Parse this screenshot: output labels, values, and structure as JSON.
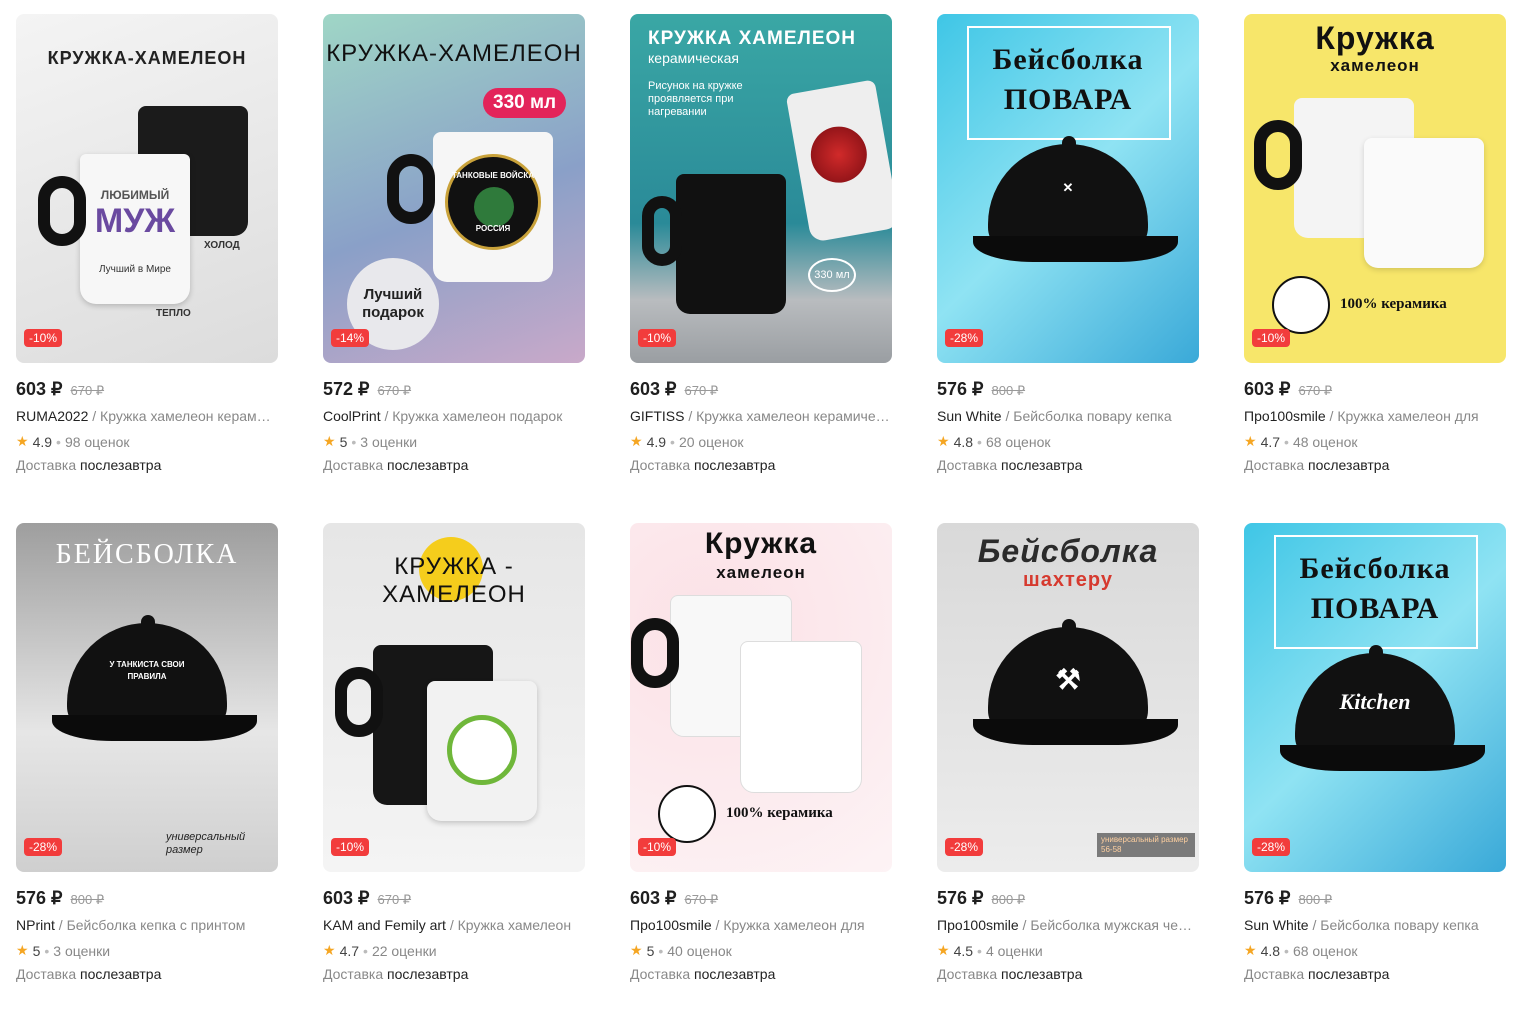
{
  "products": [
    {
      "headline": "КРУЖКА-ХАМЕЛЕОН",
      "art": [
        "ЛЮБИМЫЙ",
        "МУЖ",
        "Лучший в Мире",
        "ХОЛОД",
        "ТЕПЛО"
      ],
      "discount": "-10%",
      "price": "603 ₽",
      "old_price": "670 ₽",
      "brand": "RUMA2022",
      "name": " / Кружка хамелеон керамическая",
      "rating": "4.9",
      "reviews": "98 оценок",
      "delivery_label": "Доставка",
      "delivery_when": "послезавтра"
    },
    {
      "headline": "КРУЖКА-ХАМЕЛЕОН",
      "art": [
        "330 мл",
        "ТАНКОВЫЕ ВОЙСКА",
        "РОССИЯ",
        "Лучший подарок"
      ],
      "discount": "-14%",
      "price": "572 ₽",
      "old_price": "670 ₽",
      "brand": "CoolPrint",
      "name": " / Кружка хамелеон подарок",
      "rating": "5",
      "reviews": "3 оценки",
      "delivery_label": "Доставка",
      "delivery_when": "послезавтра"
    },
    {
      "headline": "КРУЖКА ХАМЕЛЕОН",
      "art": [
        "керамическая",
        "Рисунок на кружке проявляется при нагревании",
        "330 мл"
      ],
      "discount": "-10%",
      "price": "603 ₽",
      "old_price": "670 ₽",
      "brand": "GIFTISS",
      "name": " / Кружка хамелеон керамическая",
      "rating": "4.9",
      "reviews": "20 оценок",
      "delivery_label": "Доставка",
      "delivery_when": "послезавтра"
    },
    {
      "headline": "Бейсболка ПОВАРА",
      "art": [],
      "discount": "-28%",
      "price": "576 ₽",
      "old_price": "800 ₽",
      "brand": "Sun White",
      "name": " / Бейсболка повару кепка",
      "rating": "4.8",
      "reviews": "68 оценок",
      "delivery_label": "Доставка",
      "delivery_when": "послезавтра"
    },
    {
      "headline": "Кружка",
      "art": [
        "хамелеон",
        "100% керамика"
      ],
      "discount": "-10%",
      "price": "603 ₽",
      "old_price": "670 ₽",
      "brand": "Про100smile",
      "name": " / Кружка хамелеон для",
      "rating": "4.7",
      "reviews": "48 оценок",
      "delivery_label": "Доставка",
      "delivery_when": "послезавтра"
    },
    {
      "headline": "БЕЙСБОЛКА",
      "art": [
        "У ТАНКИСТА СВОИ ПРАВИЛА",
        "универсальный размер"
      ],
      "discount": "-28%",
      "price": "576 ₽",
      "old_price": "800 ₽",
      "brand": "NPrint",
      "name": " / Бейсболка кепка с принтом",
      "rating": "5",
      "reviews": "3 оценки",
      "delivery_label": "Доставка",
      "delivery_when": "послезавтра"
    },
    {
      "headline": "КРУЖКА - ХАМЕЛЕОН",
      "art": [],
      "discount": "-10%",
      "price": "603 ₽",
      "old_price": "670 ₽",
      "brand": "KAM and Femily art",
      "name": " / Кружка хамелеон",
      "rating": "4.7",
      "reviews": "22 оценки",
      "delivery_label": "Доставка",
      "delivery_when": "послезавтра"
    },
    {
      "headline": "Кружка",
      "art": [
        "хамелеон",
        "100% керамика"
      ],
      "discount": "-10%",
      "price": "603 ₽",
      "old_price": "670 ₽",
      "brand": "Про100smile",
      "name": " / Кружка хамелеон для",
      "rating": "5",
      "reviews": "40 оценок",
      "delivery_label": "Доставка",
      "delivery_when": "послезавтра"
    },
    {
      "headline": "Бейсболка",
      "art": [
        "шахтеру",
        "универсальный размер 56-58"
      ],
      "discount": "-28%",
      "price": "576 ₽",
      "old_price": "800 ₽",
      "brand": "Про100smile",
      "name": " / Бейсболка мужская черная",
      "rating": "4.5",
      "reviews": "4 оценки",
      "delivery_label": "Доставка",
      "delivery_when": "послезавтра"
    },
    {
      "headline": "Бейсболка ПОВАРА",
      "art": [
        "Kitchen"
      ],
      "discount": "-28%",
      "price": "576 ₽",
      "old_price": "800 ₽",
      "brand": "Sun White",
      "name": " / Бейсболка повару кепка",
      "rating": "4.8",
      "reviews": "68 оценок",
      "delivery_label": "Доставка",
      "delivery_when": "послезавтра"
    }
  ],
  "colors": {
    "discount": "#f23c3c",
    "star": "#f5a623",
    "text": "#1f1f1f",
    "muted": "#888888"
  }
}
